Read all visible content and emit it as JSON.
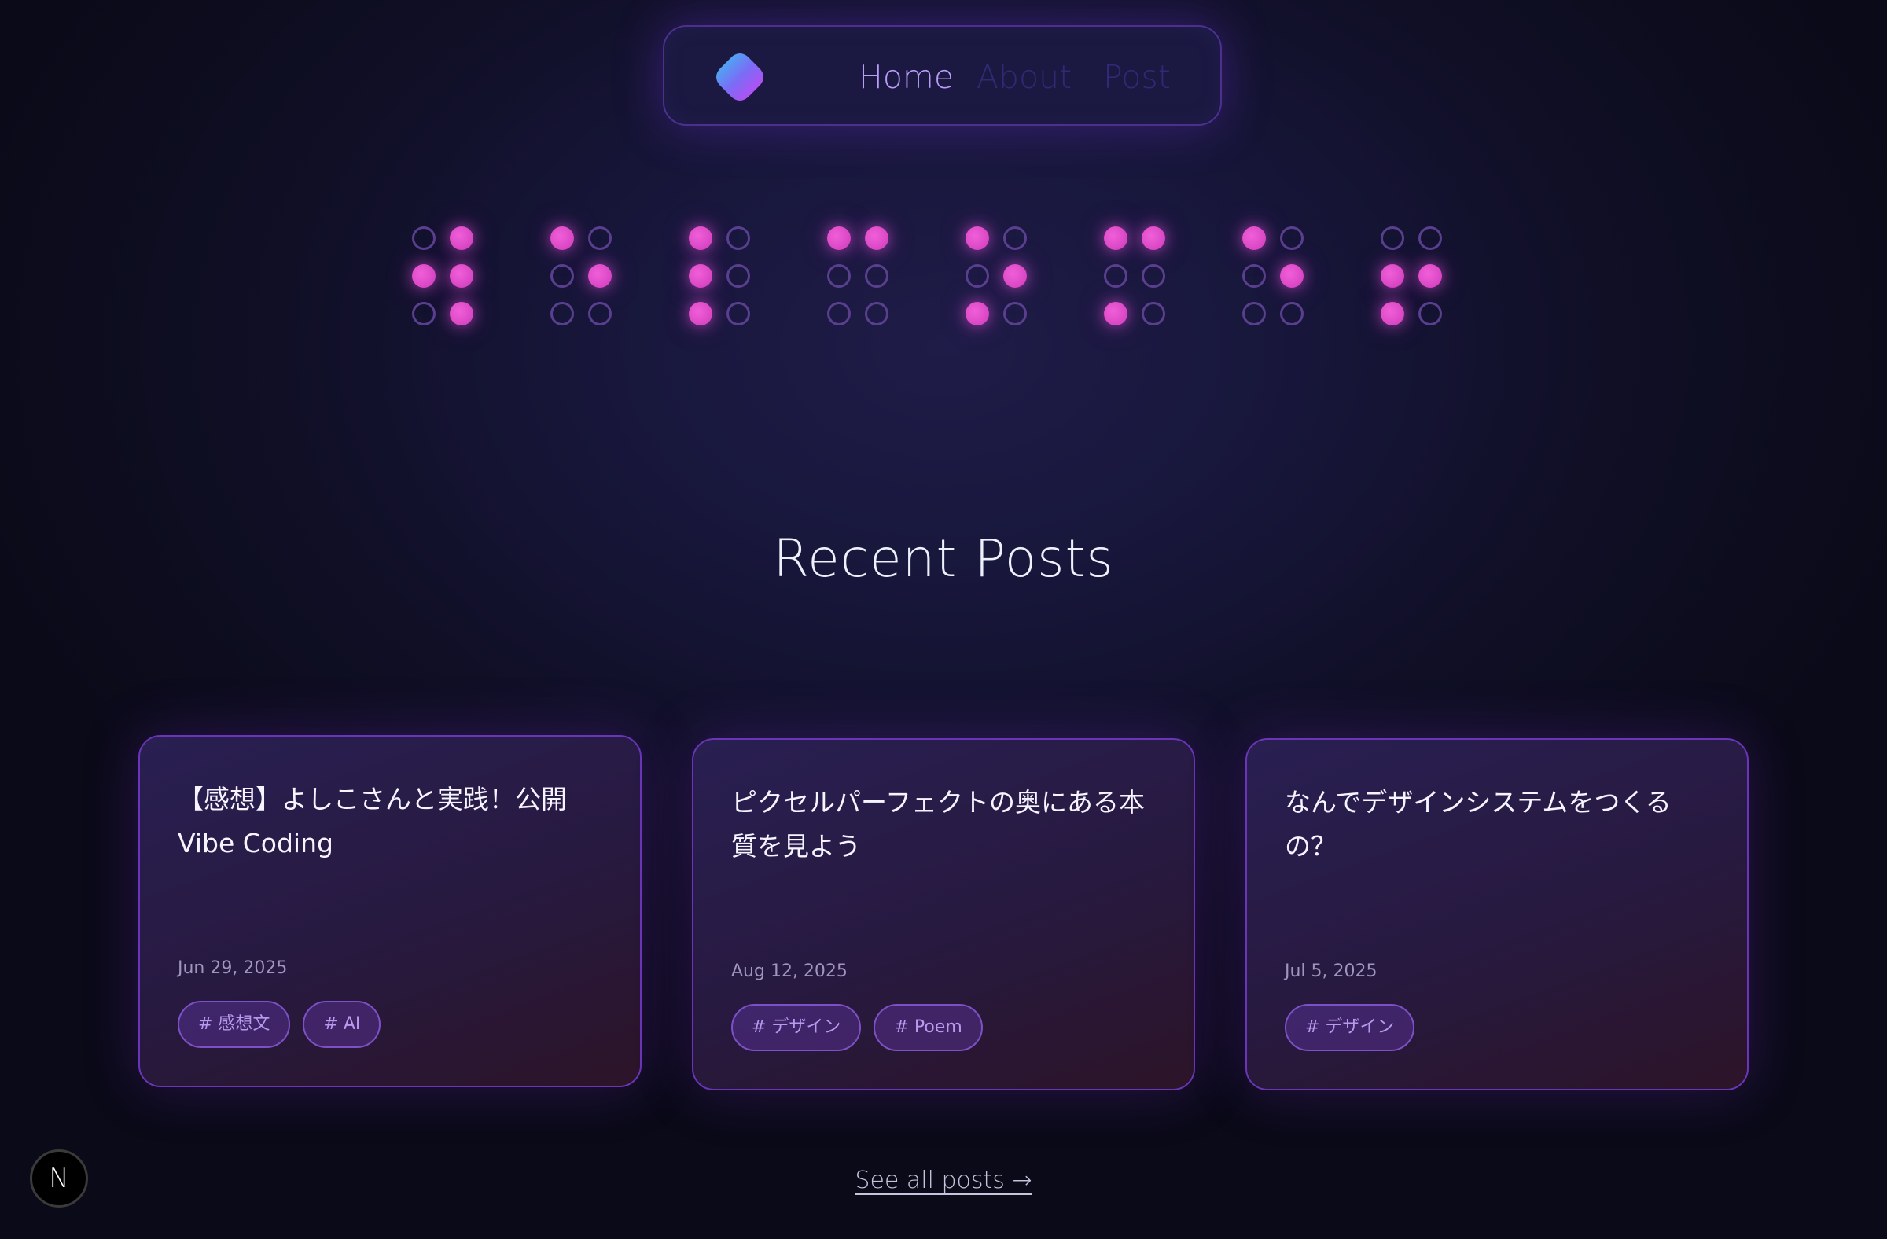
{
  "nav": {
    "items": [
      {
        "label": "Home",
        "active": true
      },
      {
        "label": "About",
        "active": false
      },
      {
        "label": "Post",
        "active": false
      }
    ]
  },
  "braille": {
    "cells": [
      [
        0,
        1,
        1,
        1,
        0,
        1
      ],
      [
        1,
        0,
        0,
        1,
        0,
        0
      ],
      [
        1,
        0,
        1,
        0,
        1,
        0
      ],
      [
        1,
        1,
        0,
        0,
        0,
        0
      ],
      [
        1,
        0,
        0,
        1,
        1,
        0
      ],
      [
        1,
        1,
        0,
        0,
        1,
        0
      ],
      [
        1,
        0,
        0,
        1,
        0,
        0
      ],
      [
        0,
        0,
        1,
        1,
        1,
        0
      ]
    ]
  },
  "section": {
    "title": "Recent Posts"
  },
  "posts": [
    {
      "title": "【感想】よしこさんと実践！公開Vibe Coding",
      "date": "Jun 29, 2025",
      "tags": [
        "# 感想文",
        "# AI"
      ]
    },
    {
      "title": "ピクセルパーフェクトの奥にある本質を見よう",
      "date": "Aug 12, 2025",
      "tags": [
        "# デザイン",
        "# Poem"
      ]
    },
    {
      "title": "なんでデザインシステムをつくるの？",
      "date": "Jul 5, 2025",
      "tags": [
        "# デザイン"
      ]
    }
  ],
  "see_all": {
    "label": "See all posts →"
  },
  "dev_badge": {
    "label": "N"
  },
  "colors": {
    "accent": "#b99dfb",
    "dot_on": "#d946c4",
    "card_border": "#6a35b8"
  },
  "icons": {
    "logo": "gradient-blob-logo-icon"
  }
}
